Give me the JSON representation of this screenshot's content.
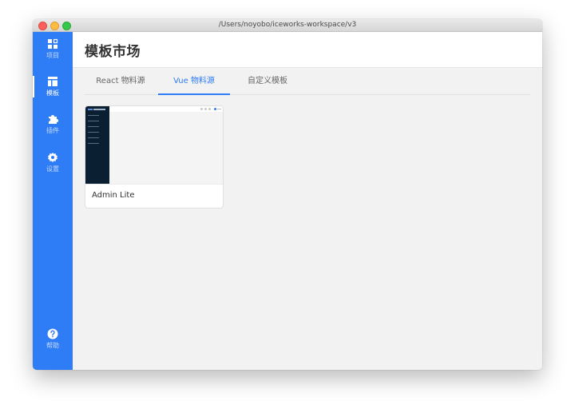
{
  "window": {
    "title": "/Users/noyobo/iceworks-workspace/v3"
  },
  "sidebar": {
    "items": [
      {
        "label": "项目",
        "icon": "dashboard-icon"
      },
      {
        "label": "模板",
        "icon": "template-icon",
        "active": true
      },
      {
        "label": "插件",
        "icon": "puzzle-icon"
      },
      {
        "label": "设置",
        "icon": "gear-icon"
      }
    ],
    "help": {
      "label": "帮助",
      "icon": "help-icon"
    }
  },
  "page": {
    "title": "模板市场"
  },
  "tabs": [
    {
      "label": "React 物料源",
      "active": false
    },
    {
      "label": "Vue 物料源",
      "active": true
    },
    {
      "label": "自定义模板",
      "active": false
    }
  ],
  "templates": [
    {
      "name": "Admin Lite",
      "preview": "admin-dashboard-thumbnail"
    }
  ],
  "colors": {
    "accent": "#2e7cf6",
    "sidebar_bg": "#2e7cf6",
    "content_bg": "#f2f2f2",
    "thumb_sidebar": "#0b1f33"
  }
}
